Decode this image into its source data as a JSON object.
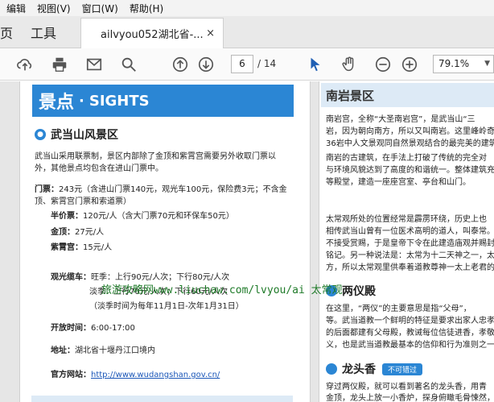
{
  "menubar": {
    "items": [
      "编辑",
      "视图(V)",
      "窗口(W)",
      "帮助(H)"
    ]
  },
  "tabs": {
    "home": "页",
    "tools": "工具",
    "doc_title": "ailvyou052湖北省-...",
    "close": "×"
  },
  "toolbar": {
    "page_current": "6",
    "page_total": "/ 14",
    "zoom": "79.1%"
  },
  "watermark": "旅游攻略网www.liuchaw.com/lvyou/ai 太常观",
  "left_page": {
    "banner_cn": "景点",
    "banner_sep": "·",
    "banner_en": "SIGHTS",
    "section_title": "武当山风景区",
    "intro": "武当山采用联票制，景区内部除了金顶和紫霄宫需要另外收取门票以外，其他景点均包含在进山门票中。",
    "ticket_label": "门票：",
    "ticket_value": "243元（含进山门票140元，观光车100元，保险费3元；不含金顶、紫霄宫门票和索道票）",
    "half_label": "半价票：",
    "half_value": "120元/人（含大门票70元和环保车50元）",
    "jinding_label": "金顶：",
    "jinding_value": "27元/人",
    "zixiao_label": "紫霄宫：",
    "zixiao_value": "15元/人",
    "bus_label": "观光缆车：",
    "bus_line1": "旺季：上行90元/人次；下行80元/人次",
    "bus_line2": "淡季：上行70元/人次；下行60元/人次",
    "bus_line3": "（淡季时间为每年11月1日-次年1月31日）",
    "hours_label": "开放时间：",
    "hours_value": "6:00-17:00",
    "addr_label": "地址：",
    "addr_value": "湖北省十堰丹江口境内",
    "site_label": "官方网站：",
    "site_value": "http://www.wudangshan.gov.cn/"
  },
  "right_page": {
    "header": "南岩景区",
    "nanyan_lines": [
      "南岩宫，全称“大圣南岩宫”，是武当山“三",
      "岩，因为朝向南方，所以又叫南岩。这里峰岭奇",
      "36岩中人文景观同自然景观结合的最完美的建筑群"
    ],
    "nanyan_lines2": [
      "南岩的古建筑，在手法上打破了传统的完全对",
      "与环境风貌达到了高度的和谐统一。整体建筑充分",
      "等殿堂，建造一座座宫室、亭台和山门。"
    ],
    "taichang_lines": [
      "太常观所处的位置经常是霹雳环绕，历史上也",
      "相传武当山曾有一位医术高明的道人，叫泰常。他",
      "不接受赏赐，于是皇帝下令在此建造庙观并赐封为",
      "铭记。另一种说法是：太常为十二天神之一，太常",
      "方，所以太常观里供奉着道教尊神一太上老君的圣"
    ],
    "liangyi_title": "两仪殿",
    "liangyi_lines": [
      "在这里，“两仪”的主要意思是指“父母”，",
      "等。武当道教一个鲜明的特征是要求出家人忠孝信",
      "的后面都建有父母殿，教诫每位信徒进香，孝敬父",
      "义，也是武当道教最基本的信仰和行为准则之一。"
    ],
    "longtou_title": "龙头香",
    "longtou_badge": "不可错过",
    "longtou_lines": [
      "穿过两仪殿，就可以看到著名的龙头香，用青",
      "金顶，龙头上放一小香炉，探身俯瞰毛骨悚然，这"
    ]
  }
}
